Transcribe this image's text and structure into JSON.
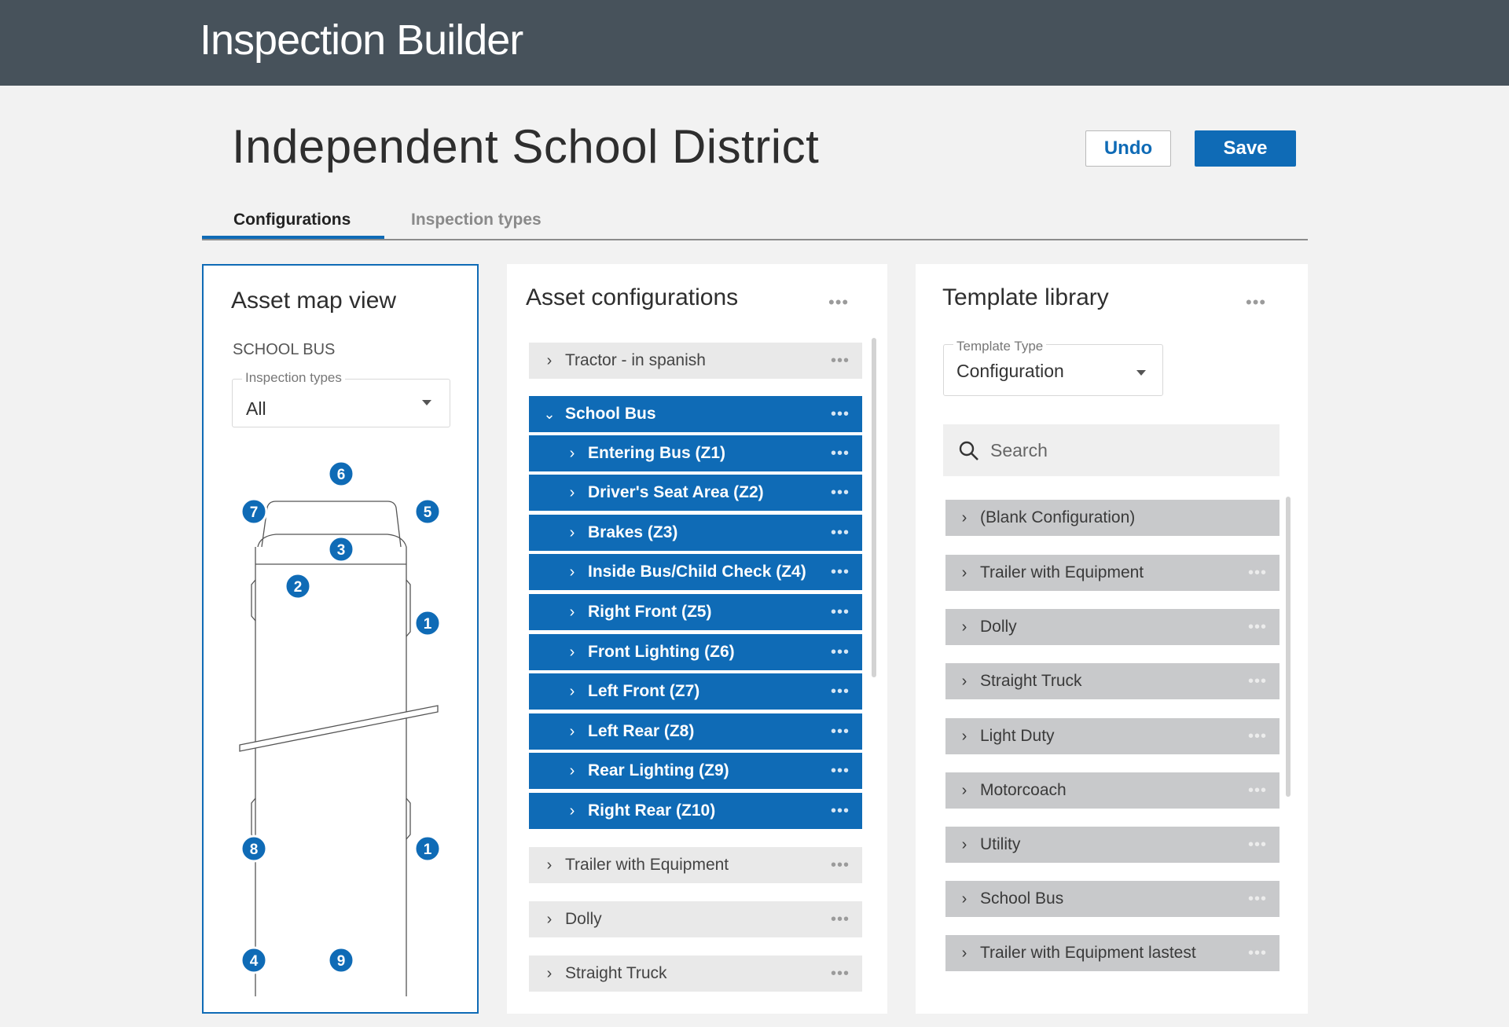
{
  "app": {
    "title": "Inspection Builder"
  },
  "page": {
    "title": "Independent School District"
  },
  "actions": {
    "undo_label": "Undo",
    "save_label": "Save"
  },
  "tabs": [
    {
      "label": "Configurations"
    },
    {
      "label": "Inspection types"
    }
  ],
  "asset_map": {
    "title": "Asset map view",
    "subtitle": "SCHOOL BUS",
    "filter": {
      "label": "Inspection types",
      "value": "All"
    },
    "markers": [
      "6",
      "7",
      "5",
      "3",
      "2",
      "1",
      "8",
      "1",
      "4",
      "9"
    ]
  },
  "asset_configurations": {
    "title": "Asset configurations",
    "menu": "•••",
    "items": [
      {
        "label": "Tractor - in spanish",
        "menu": "•••"
      },
      {
        "label": "School Bus",
        "menu": "•••",
        "children": [
          {
            "label": "Entering Bus (Z1)",
            "menu": "•••"
          },
          {
            "label": "Driver's Seat Area (Z2)",
            "menu": "•••"
          },
          {
            "label": "Brakes (Z3)",
            "menu": "•••"
          },
          {
            "label": "Inside Bus/Child Check (Z4)",
            "menu": "•••"
          },
          {
            "label": "Right Front (Z5)",
            "menu": "•••"
          },
          {
            "label": "Front Lighting (Z6)",
            "menu": "•••"
          },
          {
            "label": "Left Front (Z7)",
            "menu": "•••"
          },
          {
            "label": "Left Rear (Z8)",
            "menu": "•••"
          },
          {
            "label": "Rear Lighting (Z9)",
            "menu": "•••"
          },
          {
            "label": "Right Rear (Z10)",
            "menu": "•••"
          }
        ]
      },
      {
        "label": "Trailer with Equipment",
        "menu": "•••"
      },
      {
        "label": "Dolly",
        "menu": "•••"
      },
      {
        "label": "Straight Truck",
        "menu": "•••"
      }
    ]
  },
  "template_library": {
    "title": "Template library",
    "menu": "•••",
    "template_type": {
      "label": "Template Type",
      "value": "Configuration"
    },
    "search": {
      "placeholder": "Search"
    },
    "items": [
      {
        "label": "(Blank Configuration)",
        "menu": ""
      },
      {
        "label": "Trailer with Equipment",
        "menu": "•••"
      },
      {
        "label": "Dolly",
        "menu": "•••"
      },
      {
        "label": "Straight Truck",
        "menu": "•••"
      },
      {
        "label": "Light Duty",
        "menu": "•••"
      },
      {
        "label": "Motorcoach",
        "menu": "•••"
      },
      {
        "label": "Utility",
        "menu": "•••"
      },
      {
        "label": "School Bus",
        "menu": "•••"
      },
      {
        "label": "Trailer with Equipment lastest",
        "menu": "•••"
      }
    ]
  },
  "colors": {
    "accent": "#0f6bb6",
    "topbar": "#47525b",
    "row_gray": "#e9e9e9",
    "row_library": "#c8c9cb"
  }
}
